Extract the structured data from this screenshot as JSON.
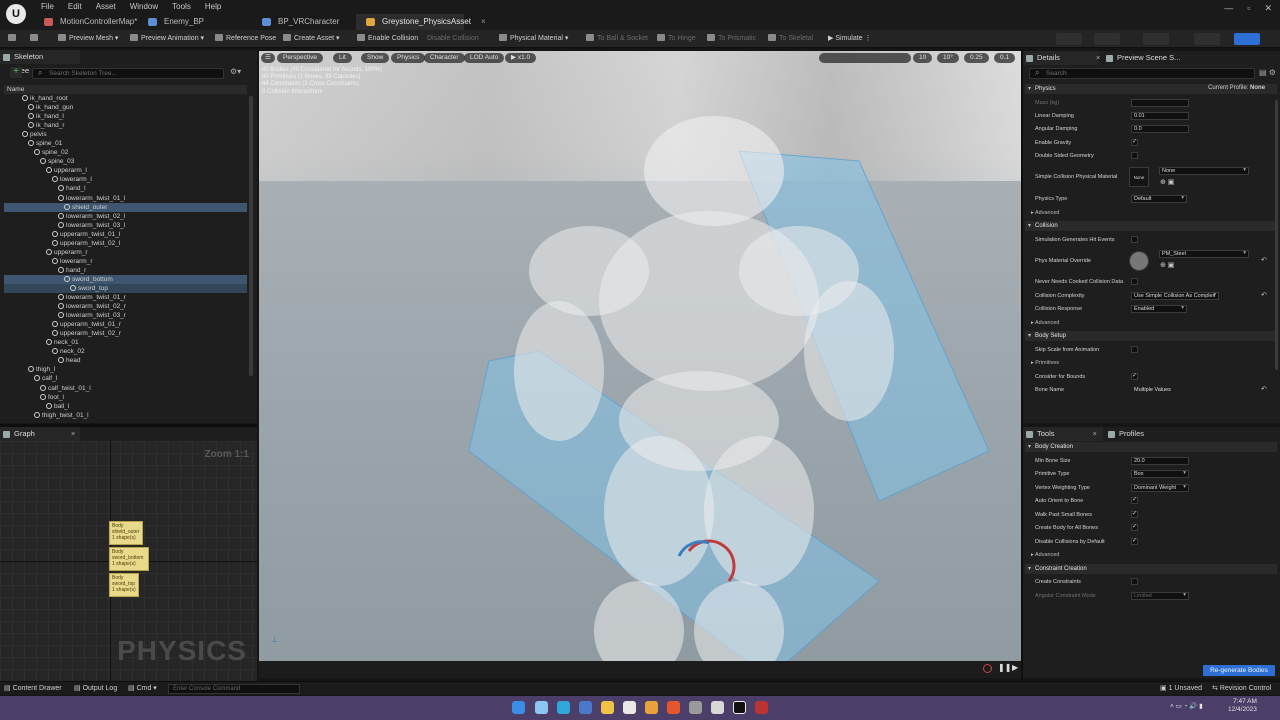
{
  "menu": [
    "File",
    "Edit",
    "Asset",
    "Window",
    "Tools",
    "Help"
  ],
  "tabs": [
    {
      "label": "MotionControllerMap*",
      "color": "#c95a5a",
      "active": false
    },
    {
      "label": "Enemy_BP",
      "color": "#5b8ed6",
      "active": false
    },
    {
      "label": "BP_VRCharacter",
      "color": "#5b8ed6",
      "active": false
    },
    {
      "label": "Greystone_PhysicsAsset",
      "color": "#e0a640",
      "active": true,
      "close": "×"
    }
  ],
  "toolbar": {
    "preview_mesh": "Preview Mesh",
    "preview_animation": "Preview Animation",
    "reference_pose": "Reference Pose",
    "create_asset": "Create Asset",
    "enable_collision": "Enable Collision",
    "disable_collision": "Disable Collision",
    "physical_material": "Physical Material",
    "to_ball_socket": "To Ball & Socket",
    "to_hinge": "To Hinge",
    "to_prismatic": "To Prismatic",
    "to_skeletal": "To Skeletal",
    "simulate": "Simulate"
  },
  "skeleton_tree": {
    "tab": "Skeleton Tree",
    "close": "×",
    "search_placeholder": "Search Skeleton Tree...",
    "column": "Name",
    "nodes": [
      {
        "label": "ik_hand_root",
        "depth": 2
      },
      {
        "label": "ik_hand_gun",
        "depth": 3
      },
      {
        "label": "ik_hand_l",
        "depth": 3
      },
      {
        "label": "ik_hand_r",
        "depth": 3
      },
      {
        "label": "pelvis",
        "depth": 2
      },
      {
        "label": "spine_01",
        "depth": 3
      },
      {
        "label": "spine_02",
        "depth": 4
      },
      {
        "label": "spine_03",
        "depth": 5
      },
      {
        "label": "upperarm_l",
        "depth": 6
      },
      {
        "label": "lowerarm_l",
        "depth": 7
      },
      {
        "label": "hand_l",
        "depth": 8
      },
      {
        "label": "lowerarm_twist_01_l",
        "depth": 8
      },
      {
        "label": "shield_outer",
        "depth": 9,
        "selected": true
      },
      {
        "label": "lowerarm_twist_02_l",
        "depth": 8
      },
      {
        "label": "lowerarm_twist_03_l",
        "depth": 8
      },
      {
        "label": "upperarm_twist_01_l",
        "depth": 7
      },
      {
        "label": "upperarm_twist_02_l",
        "depth": 7
      },
      {
        "label": "upperarm_r",
        "depth": 6
      },
      {
        "label": "lowerarm_r",
        "depth": 7
      },
      {
        "label": "hand_r",
        "depth": 8
      },
      {
        "label": "sword_bottom",
        "depth": 9,
        "selected": true
      },
      {
        "label": "sword_top",
        "depth": 10,
        "selected": true
      },
      {
        "label": "lowerarm_twist_01_r",
        "depth": 8
      },
      {
        "label": "lowerarm_twist_02_r",
        "depth": 8
      },
      {
        "label": "lowerarm_twist_03_r",
        "depth": 8
      },
      {
        "label": "upperarm_twist_01_r",
        "depth": 7
      },
      {
        "label": "upperarm_twist_02_r",
        "depth": 7
      },
      {
        "label": "neck_01",
        "depth": 6
      },
      {
        "label": "neck_02",
        "depth": 7
      },
      {
        "label": "head",
        "depth": 8
      },
      {
        "label": "thigh_l",
        "depth": 3
      },
      {
        "label": "calf_l",
        "depth": 4
      },
      {
        "label": "calf_twist_01_l",
        "depth": 5
      },
      {
        "label": "foot_l",
        "depth": 5
      },
      {
        "label": "ball_l",
        "depth": 6
      },
      {
        "label": "thigh_twist_01_l",
        "depth": 4
      }
    ]
  },
  "graph": {
    "tab": "Graph",
    "close": "×",
    "zoom": "Zoom 1:1",
    "watermark": "PHYSICS",
    "nodes": [
      {
        "lines": [
          "Body",
          "shield_outer",
          "1 shape(s)"
        ]
      },
      {
        "lines": [
          "Body",
          "sword_bottom",
          "1 shape(s)"
        ]
      },
      {
        "lines": [
          "Body",
          "sword_top",
          "1 shape(s)"
        ]
      }
    ]
  },
  "viewport": {
    "buttons": [
      "Perspective",
      "Lit",
      "Show",
      "Physics",
      "Character",
      "LOD Auto",
      "x1.0"
    ],
    "right_values": [
      "10",
      "1",
      "10°",
      "0.25",
      "0.1"
    ],
    "stats": [
      "40 Bodies (40 Considered for bounds, 100%)",
      "40 Primitives (1 Boxes, 39 Capsules)",
      "44 Constraints (1 Cross Constraints)",
      "0 Collision Interactions"
    ]
  },
  "details": {
    "tab": "Details",
    "close": "×",
    "tab2": "Preview Scene S...",
    "search_placeholder": "Search",
    "physics_header": "Physics",
    "current_profile_label": "Current Profile:",
    "current_profile_value": "None",
    "mass_label": "Mass (kg)",
    "linear_damping_label": "Linear Damping",
    "linear_damping_value": "0.01",
    "angular_damping_label": "Angular Damping",
    "angular_damping_value": "0.0",
    "enable_gravity_label": "Enable Gravity",
    "double_sided_label": "Double Sided Geometry",
    "simple_collision_label": "Simple Collision Physical Material",
    "simple_collision_thumb": "None",
    "simple_collision_value": "None",
    "physics_type_label": "Physics Type",
    "physics_type_value": "Default",
    "advanced_label": "Advanced",
    "collision_header": "Collision",
    "sim_hit_events_label": "Simulation Generates Hit Events",
    "phys_material_override_label": "Phys Material Override",
    "phys_material_override_value": "PM_Steel",
    "never_cooked_label": "Never Needs Cooked Collision Data",
    "collision_complexity_label": "Collision Complexity",
    "collision_complexity_value": "Use Simple Collision As Complex",
    "collision_response_label": "Collision Response",
    "collision_response_value": "Enabled",
    "advanced2_label": "Advanced",
    "body_setup_header": "Body Setup",
    "skip_scale_label": "Skip Scale from Animation",
    "primitives_label": "Primitives",
    "consider_bounds_label": "Consider for Bounds",
    "bone_name_label": "Bone Name",
    "bone_name_value": "Multiple Values",
    "check": "✓",
    "reset": "↶"
  },
  "tools": {
    "tab": "Tools",
    "close": "×",
    "tab2": "Profiles",
    "body_creation_header": "Body Creation",
    "min_bone_size_label": "Min Bone Size",
    "min_bone_size_value": "20.0",
    "primitive_type_label": "Primitive Type",
    "primitive_type_value": "Box",
    "vertex_weighting_label": "Vertex Weighting Type",
    "vertex_weighting_value": "Dominant Weight",
    "auto_orient_label": "Auto Orient to Bone",
    "walk_past_label": "Walk Past Small Bones",
    "create_body_label": "Create Body for All Bones",
    "disable_collisions_label": "Disable Collisions by Default",
    "advanced_label": "Advanced",
    "constraint_creation_header": "Constraint Creation",
    "create_constraints_label": "Create Constraints",
    "angular_mode_label": "Angular Constraint Mode",
    "angular_mode_value": "Limited",
    "check": "✓",
    "regen_button": "Re-generate Bodies"
  },
  "statusbar": {
    "content_drawer": "Content Drawer",
    "output_log": "Output Log",
    "cmd": "Cmd",
    "console_placeholder": "Enter Console Command",
    "unsaved": "1 Unsaved",
    "revision_control": "Revision Control"
  },
  "taskbar": {
    "time": "7:47 AM",
    "date": "12/4/2023"
  },
  "colors": {
    "accent": "#2e6fd3",
    "selection": "#3f5670",
    "taskbar": "#4b3e68",
    "node": "#e9d98a"
  }
}
